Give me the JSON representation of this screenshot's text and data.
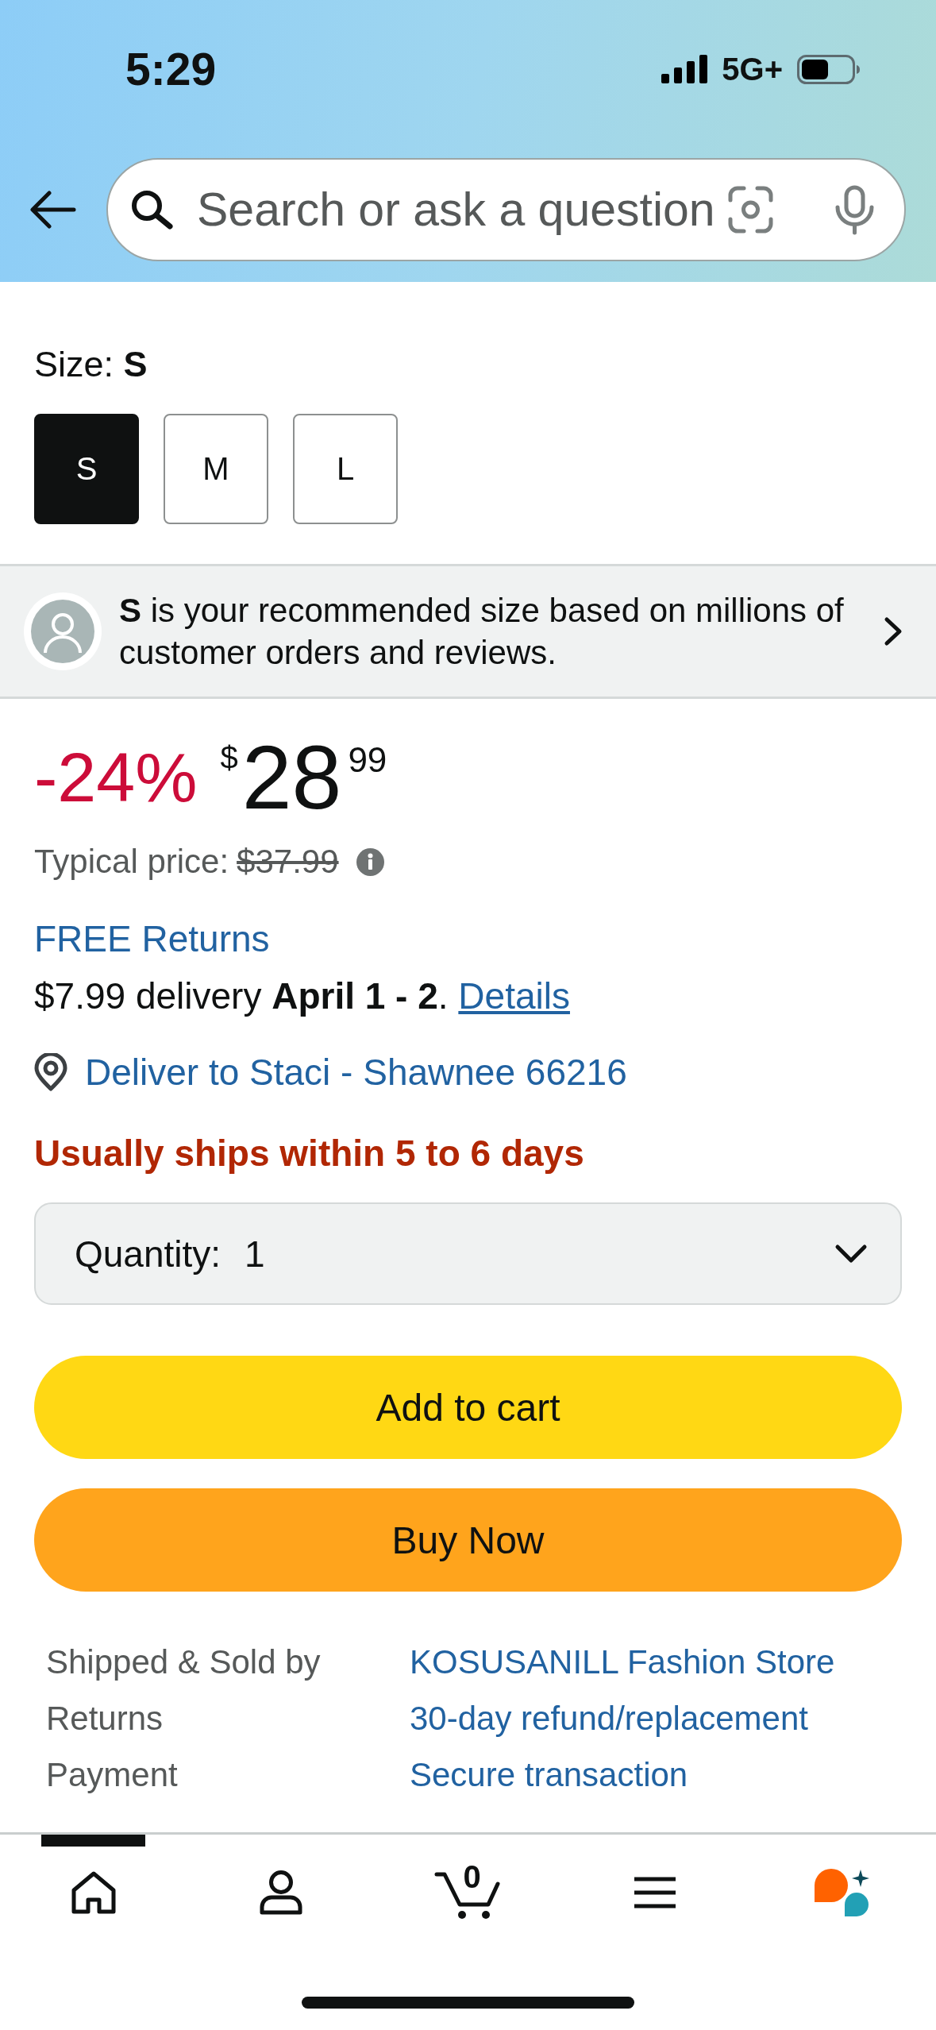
{
  "status_bar": {
    "time": "5:29",
    "network": "5G+"
  },
  "search": {
    "placeholder": "Search or ask a question"
  },
  "size": {
    "label": "Size: **S**",
    "options": [
      {
        "label": "S",
        "selected": true
      },
      {
        "label": "M",
        "selected": false
      },
      {
        "label": "L",
        "selected": false
      }
    ]
  },
  "size_recommendation": "**S** is your recommended size based on millions of customer orders and reviews.",
  "price": {
    "discount": "-24%",
    "currency": "$",
    "whole": "28",
    "fraction": "99",
    "typical_label": "Typical price:",
    "typical_value": "$37.99"
  },
  "returns_link": "FREE Returns",
  "delivery": {
    "text": "$7.99 delivery **April 1 - 2**.",
    "link": "Details"
  },
  "location": "Deliver to Staci - Shawnee 66216",
  "availability": "Usually ships within 5 to 6 days",
  "quantity": {
    "label": "Quantity:",
    "value": "1"
  },
  "buttons": [
    {
      "kind": "add_to_cart",
      "label": "Add to cart"
    },
    {
      "kind": "buy_now",
      "label": "Buy Now"
    }
  ],
  "details": [
    {
      "label": "Shipped & Sold by",
      "value": "KOSUSANILL Fashion Store"
    },
    {
      "label": "Returns",
      "value": "30-day refund/replacement"
    },
    {
      "label": "Payment",
      "value": "Secure transaction"
    }
  ],
  "tab_bar": [
    {
      "kind": "home",
      "selected": true
    },
    {
      "kind": "account",
      "selected": false
    },
    {
      "kind": "cart",
      "count": "0",
      "selected": false
    },
    {
      "kind": "menu",
      "selected": false
    },
    {
      "kind": "assistant",
      "selected": false
    }
  ]
}
